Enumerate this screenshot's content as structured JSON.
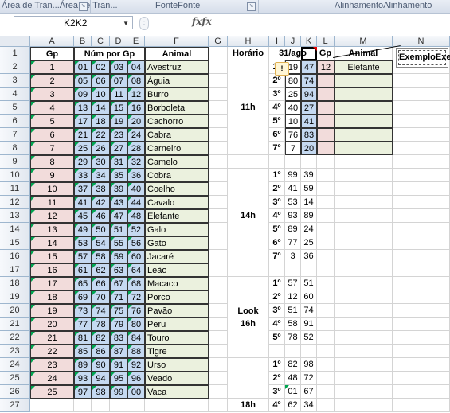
{
  "ribbon": {
    "groups": [
      "Área de Tran...",
      "Fonte",
      "Alinhamento"
    ]
  },
  "formula_bar": {
    "name_box": "K2",
    "fx_label": "fx",
    "formula": ""
  },
  "columns": [
    "A",
    "B",
    "C",
    "D",
    "E",
    "F",
    "G",
    "H",
    "I",
    "J",
    "K",
    "L",
    "M",
    "N"
  ],
  "rows": [
    "1",
    "2",
    "3",
    "4",
    "5",
    "6",
    "7",
    "8",
    "9",
    "10",
    "11",
    "12",
    "13",
    "14",
    "15",
    "16",
    "17",
    "18",
    "19",
    "20",
    "21",
    "22",
    "23",
    "24",
    "25",
    "26",
    "27"
  ],
  "headers": {
    "gp": "Gp",
    "num_por_gp": "Núm por Gp",
    "animal": "Animal",
    "horario": "Horário",
    "date": "31/ago",
    "gp2": "Gp",
    "animal2": "Animal"
  },
  "groups": [
    {
      "gp": "1",
      "n": [
        "01",
        "02",
        "03",
        "04"
      ],
      "animal": "Avestruz"
    },
    {
      "gp": "2",
      "n": [
        "05",
        "06",
        "07",
        "08"
      ],
      "animal": "Águia"
    },
    {
      "gp": "3",
      "n": [
        "09",
        "10",
        "11",
        "12"
      ],
      "animal": "Burro"
    },
    {
      "gp": "4",
      "n": [
        "13",
        "14",
        "15",
        "16"
      ],
      "animal": "Borboleta"
    },
    {
      "gp": "5",
      "n": [
        "17",
        "18",
        "19",
        "20"
      ],
      "animal": "Cachorro"
    },
    {
      "gp": "6",
      "n": [
        "21",
        "22",
        "23",
        "24"
      ],
      "animal": "Cabra"
    },
    {
      "gp": "7",
      "n": [
        "25",
        "26",
        "27",
        "28"
      ],
      "animal": "Carneiro"
    },
    {
      "gp": "8",
      "n": [
        "29",
        "30",
        "31",
        "32"
      ],
      "animal": "Camelo"
    },
    {
      "gp": "9",
      "n": [
        "33",
        "34",
        "35",
        "36"
      ],
      "animal": "Cobra"
    },
    {
      "gp": "10",
      "n": [
        "37",
        "38",
        "39",
        "40"
      ],
      "animal": "Coelho"
    },
    {
      "gp": "11",
      "n": [
        "41",
        "42",
        "43",
        "44"
      ],
      "animal": "Cavalo"
    },
    {
      "gp": "12",
      "n": [
        "45",
        "46",
        "47",
        "48"
      ],
      "animal": "Elefante"
    },
    {
      "gp": "13",
      "n": [
        "49",
        "50",
        "51",
        "52"
      ],
      "animal": "Galo"
    },
    {
      "gp": "14",
      "n": [
        "53",
        "54",
        "55",
        "56"
      ],
      "animal": "Gato"
    },
    {
      "gp": "15",
      "n": [
        "57",
        "58",
        "59",
        "60"
      ],
      "animal": "Jacaré"
    },
    {
      "gp": "16",
      "n": [
        "61",
        "62",
        "63",
        "64"
      ],
      "animal": "Leão"
    },
    {
      "gp": "17",
      "n": [
        "65",
        "66",
        "67",
        "68"
      ],
      "animal": "Macaco"
    },
    {
      "gp": "18",
      "n": [
        "69",
        "70",
        "71",
        "72"
      ],
      "animal": "Porco"
    },
    {
      "gp": "19",
      "n": [
        "73",
        "74",
        "75",
        "76"
      ],
      "animal": "Pavão"
    },
    {
      "gp": "20",
      "n": [
        "77",
        "78",
        "79",
        "80"
      ],
      "animal": "Peru"
    },
    {
      "gp": "21",
      "n": [
        "81",
        "82",
        "83",
        "84"
      ],
      "animal": "Touro"
    },
    {
      "gp": "22",
      "n": [
        "85",
        "86",
        "87",
        "88"
      ],
      "animal": "Tigre"
    },
    {
      "gp": "23",
      "n": [
        "89",
        "90",
        "91",
        "92"
      ],
      "animal": "Urso"
    },
    {
      "gp": "24",
      "n": [
        "93",
        "94",
        "95",
        "96"
      ],
      "animal": "Veado"
    },
    {
      "gp": "25",
      "n": [
        "97",
        "98",
        "99",
        "00"
      ],
      "animal": "Vaca"
    }
  ],
  "draws": [
    {
      "row": 2,
      "ord": "1º",
      "j": "19",
      "k": "47",
      "l": "12",
      "m": "Elefante"
    },
    {
      "row": 3,
      "ord": "2º",
      "j": "80",
      "k": "74",
      "l": "",
      "m": ""
    },
    {
      "row": 4,
      "ord": "3º",
      "j": "25",
      "k": "94",
      "l": "",
      "m": ""
    },
    {
      "row": 5,
      "ord": "4º",
      "j": "40",
      "k": "27",
      "l": "",
      "m": ""
    },
    {
      "row": 6,
      "ord": "5º",
      "j": "10",
      "k": "41",
      "l": "",
      "m": ""
    },
    {
      "row": 7,
      "ord": "6º",
      "j": "76",
      "k": "83",
      "l": "",
      "m": ""
    },
    {
      "row": 8,
      "ord": "7º",
      "j": "7",
      "k": "20",
      "l": "",
      "m": ""
    },
    {
      "row": 10,
      "ord": "1º",
      "j": "99",
      "k": "39"
    },
    {
      "row": 11,
      "ord": "2º",
      "j": "41",
      "k": "59"
    },
    {
      "row": 12,
      "ord": "3º",
      "j": "53",
      "k": "14"
    },
    {
      "row": 13,
      "ord": "4º",
      "j": "93",
      "k": "89"
    },
    {
      "row": 14,
      "ord": "5º",
      "j": "89",
      "k": "24"
    },
    {
      "row": 15,
      "ord": "6º",
      "j": "77",
      "k": "25"
    },
    {
      "row": 16,
      "ord": "7º",
      "j": "3",
      "k": "36"
    },
    {
      "row": 18,
      "ord": "1º",
      "j": "57",
      "k": "51"
    },
    {
      "row": 19,
      "ord": "2º",
      "j": "12",
      "k": "60"
    },
    {
      "row": 20,
      "ord": "3º",
      "j": "51",
      "k": "74"
    },
    {
      "row": 21,
      "ord": "4º",
      "j": "58",
      "k": "91"
    },
    {
      "row": 22,
      "ord": "5º",
      "j": "78",
      "k": "52"
    },
    {
      "row": 24,
      "ord": "1º",
      "j": "82",
      "k": "98"
    },
    {
      "row": 25,
      "ord": "2º",
      "j": "48",
      "k": "72"
    },
    {
      "row": 26,
      "ord": "3º",
      "j": "01",
      "k": "67"
    },
    {
      "row": 27,
      "ord": "4º",
      "j": "62",
      "k": "34"
    }
  ],
  "times": [
    {
      "label": "11h"
    },
    {
      "label": "14h"
    },
    {
      "label": "Look\n16h"
    },
    {
      "label": "18h"
    }
  ],
  "comment": "Exemplo",
  "colors": {
    "pink": "#f2dcdb",
    "blue": "#c5d9f1",
    "green": "#ebf1de",
    "header": "#e1e7ef"
  }
}
